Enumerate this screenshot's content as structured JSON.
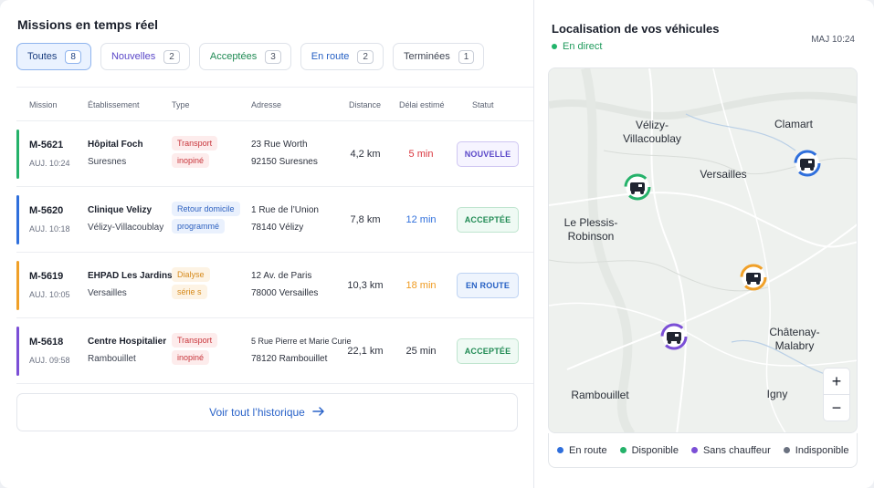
{
  "header": {
    "title": "Missions en temps réel"
  },
  "filters": [
    {
      "label": "Toutes",
      "count": "8"
    },
    {
      "label": "Nouvelles",
      "count": "2"
    },
    {
      "label": "Acceptées",
      "count": "3"
    },
    {
      "label": "En route",
      "count": "2"
    },
    {
      "label": "Terminées",
      "count": "1"
    }
  ],
  "table": {
    "columns": [
      "Mission",
      "Établissement",
      "Type",
      "Adresse",
      "Distance",
      "Délai estimé",
      "Statut"
    ],
    "rows": [
      {
        "id": "M-5621",
        "time": "AUJ. 10:24",
        "est_name": "Hôpital Foch",
        "est_city": "Suresnes",
        "type1": "Transport",
        "type2": "inopiné",
        "addr1": "23 Rue Worth",
        "addr2": "92150 Suresnes",
        "distance": "4,2 km",
        "delay": "5 min",
        "status": "NOUVELLE"
      },
      {
        "id": "M-5620",
        "time": "AUJ. 10:18",
        "est_name": "Clinique Velizy",
        "est_city": "Vélizy-Villacoublay",
        "type1": "Retour domicile",
        "type2": "programmé",
        "addr1": "1 Rue de l’Union",
        "addr2": "78140 Vélizy",
        "distance": "7,8 km",
        "delay": "12 min",
        "status": "ACCEPTÉE"
      },
      {
        "id": "M-5619",
        "time": "AUJ. 10:05",
        "est_name": "EHPAD Les Jardins",
        "est_city": "Versailles",
        "type1": "Dialyse",
        "type2": "série s",
        "addr1": "12 Av. de Paris",
        "addr2": "78000 Versailles",
        "distance": "10,3 km",
        "delay": "18 min",
        "status": "EN ROUTE"
      },
      {
        "id": "M-5618",
        "time": "AUJ. 09:58",
        "est_name": "Centre Hospitalier",
        "est_city": "Rambouillet",
        "type1": "Transport",
        "type2": "inopiné",
        "addr1": "5 Rue Pierre et Marie Curie",
        "addr2": "78120 Rambouillet",
        "distance": "22,1 km",
        "delay": "25 min",
        "status": "ACCEPTÉE"
      }
    ]
  },
  "history": {
    "label": "Voir tout l’historique"
  },
  "map": {
    "title": "Localisation de vos véhicules",
    "live_label": "En direct",
    "updated": "MAJ 10:24",
    "cities": {
      "velizy_1": "Vélizy-",
      "velizy_2": "Villacoublay",
      "clamart": "Clamart",
      "versailles": "Versailles",
      "plessis_1": "Le Plessis-",
      "plessis_2": "Robinson",
      "chatenay_1": "Châtenay-",
      "chatenay_2": "Malabry",
      "rambouillet": "Rambouillet",
      "igny": "Igny"
    },
    "zoom_in": "+",
    "zoom_out": "−",
    "legend": [
      "En route",
      "Disponible",
      "Sans chauffeur",
      "Indisponible"
    ]
  },
  "colors": {
    "blue": "#2f6fdc",
    "green": "#25b26a",
    "orange": "#f0a028",
    "purple": "#7b4fd6",
    "gray": "#6b7280",
    "red": "#d9363e"
  }
}
